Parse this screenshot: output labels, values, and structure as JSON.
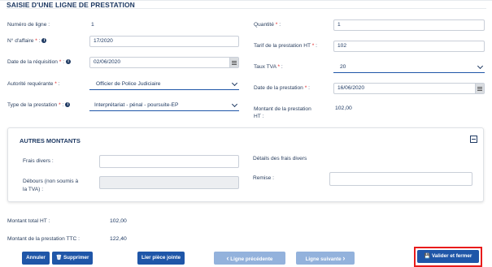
{
  "form": {
    "title": "Saisie d'une ligne de prestation",
    "left_fields": {
      "numero_label": "Numéro de ligne :",
      "numero_value": "1",
      "affaire_label": "N° d'affaire",
      "affaire_value": "17/2020",
      "requisition_label": "Date de la réquisition",
      "requisition_value": "02/06/2020",
      "autorite_label": "Autorité requérante",
      "autorite_value": "Officier de Police Judiciaire",
      "type_label": "Type de la prestation",
      "type_value": "Interprétariat - pénal - poursuite-EP"
    },
    "right_fields": {
      "quantite_label": "Quantité",
      "quantite_value": "1",
      "tarif_label": "Tarif de la prestation HT",
      "tarif_value": "102",
      "tva_label": "Taux TVA",
      "tva_value": "20",
      "date_prestation_label": "Date de la prestation",
      "date_prestation_value": "16/06/2020",
      "montant_label_1": "Montant de la prestation",
      "montant_label_2": "HT :",
      "montant_value": "102,00"
    },
    "required_mark": "*",
    "colon": ":"
  },
  "autres": {
    "title": "Autres montants",
    "frais_label": "Frais divers :",
    "frais_value": "",
    "debours_label_1": "Débours (non soumis à",
    "debours_label_2": "la TVA) :",
    "debours_value": "",
    "details_label": "Détails des frais divers",
    "remise_label": "Remise :",
    "remise_value": ""
  },
  "totals": {
    "total_ht_label": "Montant total HT :",
    "total_ht_value": "102,00",
    "total_ttc_label": "Montant de la prestation TTC :",
    "total_ttc_value": "122,40"
  },
  "buttons": {
    "annuler": "Annuler",
    "supprimer": "Supprimer",
    "lier": "Lier pièce jointe",
    "precedente": "Ligne précédente",
    "suivante": "Ligne suivante",
    "valider": "Valider et fermer"
  },
  "icons": {
    "info": "i",
    "trash": "🗑",
    "chevron_left": "‹",
    "chevron_right": "›",
    "save": "💾"
  }
}
